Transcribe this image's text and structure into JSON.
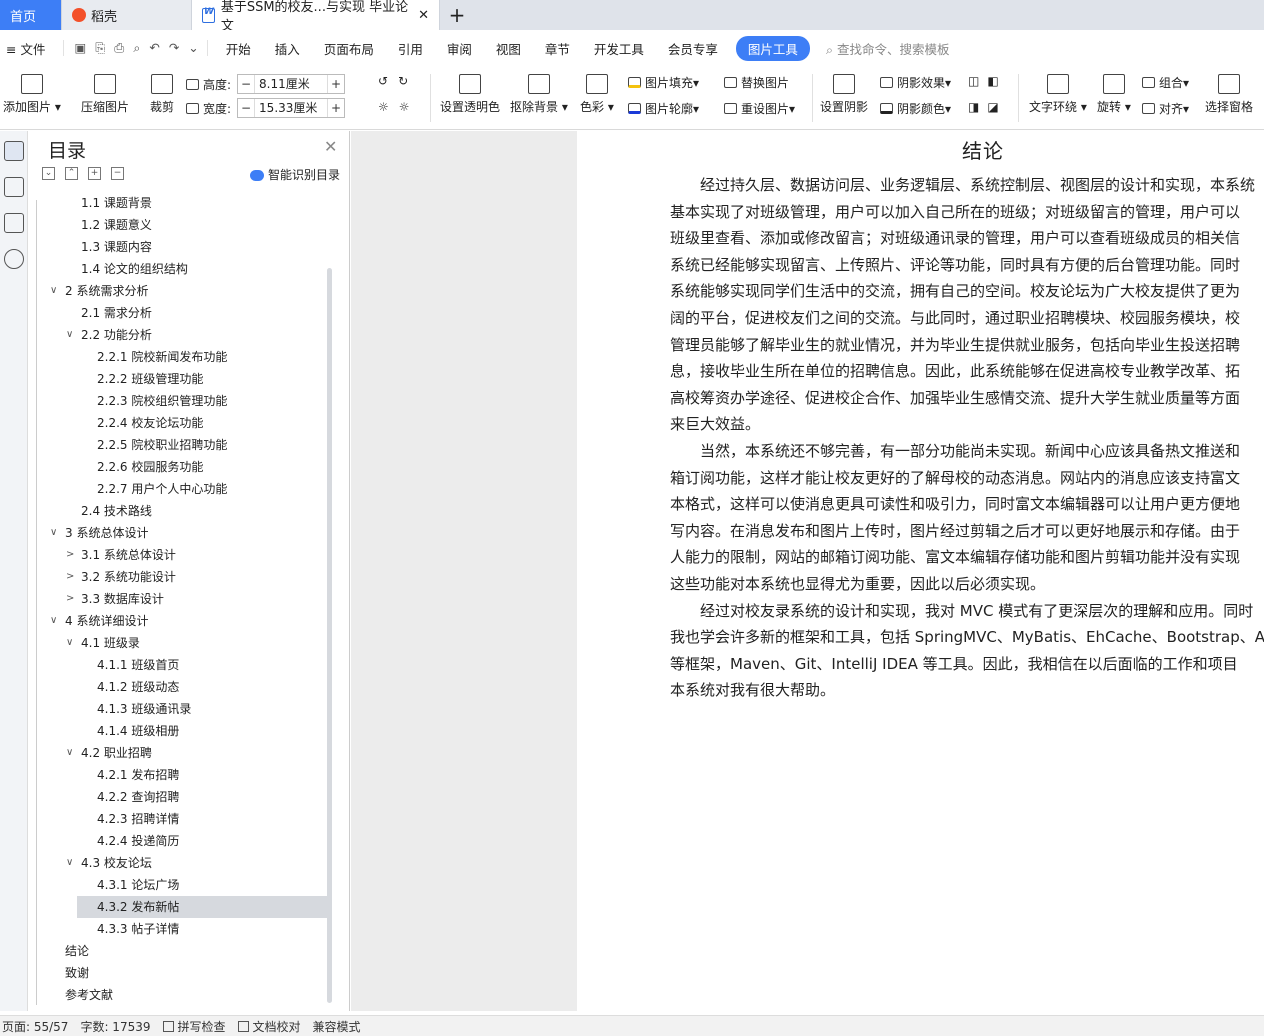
{
  "tabs": {
    "home": "首页",
    "daoke": "稻壳",
    "doc": "基于SSM的校友...与实现 毕业论文"
  },
  "menu": {
    "file": "文件",
    "items": [
      "开始",
      "插入",
      "页面布局",
      "引用",
      "审阅",
      "视图",
      "章节",
      "开发工具",
      "会员专享"
    ],
    "active": "图片工具",
    "search": "查找命令、搜索模板"
  },
  "ribbon": {
    "add_image": "添加图片",
    "compress": "压缩图片",
    "crop": "裁剪",
    "height_label": "高度:",
    "height_value": "8.11厘米",
    "width_label": "宽度:",
    "width_value": "15.33厘米",
    "transparent": "设置透明色",
    "remove_bg": "抠除背景",
    "color": "色彩",
    "fill": "图片填充",
    "outline": "图片轮廓",
    "replace": "替换图片",
    "reset": "重设图片",
    "shadow_set": "设置阴影",
    "shadow_effect": "阴影效果",
    "shadow_color": "阴影颜色",
    "wrap": "文字环绕",
    "rotate": "旋转",
    "group": "组合",
    "align": "对齐",
    "select_pane": "选择窗格"
  },
  "toc": {
    "title": "目录",
    "smart": "智能识别目录",
    "items": [
      {
        "label": "1.1  课题背景",
        "level": 2
      },
      {
        "label": "1.2  课题意义",
        "level": 2
      },
      {
        "label": "1.3  课题内容",
        "level": 2
      },
      {
        "label": "1.4  论文的组织结构",
        "level": 2
      },
      {
        "label": "2  系统需求分析",
        "level": 1,
        "arrow": "∨"
      },
      {
        "label": "2.1  需求分析",
        "level": 2
      },
      {
        "label": "2.2  功能分析",
        "level": 2,
        "arrow": "∨"
      },
      {
        "label": "2.2.1  院校新闻发布功能",
        "level": 3
      },
      {
        "label": "2.2.2  班级管理功能",
        "level": 3
      },
      {
        "label": "2.2.3  院校组织管理功能",
        "level": 3
      },
      {
        "label": "2.2.4  校友论坛功能",
        "level": 3
      },
      {
        "label": "2.2.5  院校职业招聘功能",
        "level": 3
      },
      {
        "label": "2.2.6  校园服务功能",
        "level": 3
      },
      {
        "label": "2.2.7  用户个人中心功能",
        "level": 3
      },
      {
        "label": "2.4  技术路线",
        "level": 2
      },
      {
        "label": "3  系统总体设计",
        "level": 1,
        "arrow": "∨"
      },
      {
        "label": "3.1  系统总体设计",
        "level": 2,
        "arrow": ">"
      },
      {
        "label": "3.2  系统功能设计",
        "level": 2,
        "arrow": ">"
      },
      {
        "label": "3.3  数据库设计",
        "level": 2,
        "arrow": ">"
      },
      {
        "label": "4  系统详细设计",
        "level": 1,
        "arrow": "∨"
      },
      {
        "label": "4.1  班级录",
        "level": 2,
        "arrow": "∨"
      },
      {
        "label": "4.1.1  班级首页",
        "level": 3
      },
      {
        "label": "4.1.2  班级动态",
        "level": 3
      },
      {
        "label": "4.1.3  班级通讯录",
        "level": 3
      },
      {
        "label": "4.1.4  班级相册",
        "level": 3
      },
      {
        "label": "4.2  职业招聘",
        "level": 2,
        "arrow": "∨"
      },
      {
        "label": "4.2.1  发布招聘",
        "level": 3
      },
      {
        "label": "4.2.2  查询招聘",
        "level": 3
      },
      {
        "label": "4.2.3  招聘详情",
        "level": 3
      },
      {
        "label": "4.2.4  投递简历",
        "level": 3
      },
      {
        "label": "4.3  校友论坛",
        "level": 2,
        "arrow": "∨"
      },
      {
        "label": "4.3.1  论坛广场",
        "level": 3
      },
      {
        "label": "4.3.2  发布新帖",
        "level": 3,
        "selected": true
      },
      {
        "label": "4.3.3  帖子详情",
        "level": 3
      },
      {
        "label": "结论",
        "level": 1
      },
      {
        "label": "致谢",
        "level": 1
      },
      {
        "label": "参考文献",
        "level": 1
      }
    ]
  },
  "doc": {
    "heading": "结论",
    "lines": [
      "　　经过持久层、数据访问层、业务逻辑层、系统控制层、视图层的设计和实现，本系统",
      "基本实现了对班级管理，用户可以加入自己所在的班级；对班级留言的管理，用户可以",
      "班级里查看、添加或修改留言；对班级通讯录的管理，用户可以查看班级成员的相关信",
      "系统已经能够实现留言、上传照片、评论等功能，同时具有方便的后台管理功能。同时",
      "系统能够实现同学们生活中的交流，拥有自己的空间。校友论坛为广大校友提供了更为",
      "阔的平台，促进校友们之间的交流。与此同时，通过职业招聘模块、校园服务模块，校",
      "管理员能够了解毕业生的就业情况，并为毕业生提供就业服务，包括向毕业生投送招聘",
      "息，接收毕业生所在单位的招聘信息。因此，此系统能够在促进高校专业教学改革、拓",
      "高校筹资办学途径、促进校企合作、加强毕业生感情交流、提升大学生就业质量等方面",
      "来巨大效益。",
      "　　当然，本系统还不够完善，有一部分功能尚未实现。新闻中心应该具备热文推送和",
      "箱订阅功能，这样才能让校友更好的了解母校的动态消息。网站内的消息应该支持富文",
      "本格式，这样可以使消息更具可读性和吸引力，同时富文本编辑器可以让用户更方便地",
      "写内容。在消息发布和图片上传时，图片经过剪辑之后才可以更好地展示和存储。由于",
      "人能力的限制，网站的邮箱订阅功能、富文本编辑存储功能和图片剪辑功能并没有实现",
      "这些功能对本系统也显得尤为重要，因此以后必须实现。",
      "　　经过对校友录系统的设计和实现，我对 MVC 模式有了更深层次的理解和应用。同时",
      "我也学会许多新的框架和工具，包括 SpringMVC、MyBatis、EhCache、Bootstrap、Amaze",
      "等框架，Maven、Git、IntelliJ IDEA 等工具。因此，我相信在以后面临的工作和项目",
      "本系统对我有很大帮助。"
    ]
  },
  "status": {
    "page": "页面: 55/57",
    "words": "字数: 17539",
    "spell": "拼写检查",
    "proof": "文档校对",
    "compat": "兼容模式"
  }
}
